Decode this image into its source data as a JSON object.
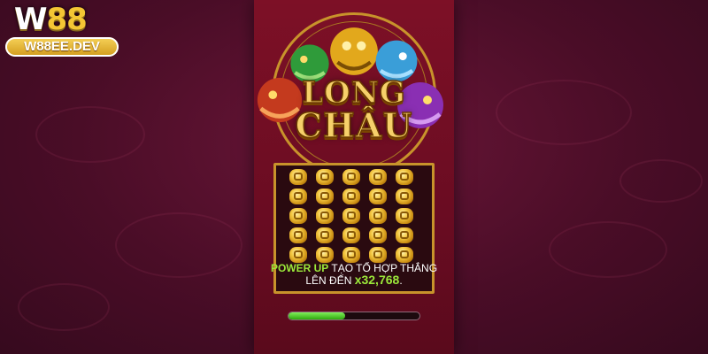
{
  "brand": {
    "mark_prefix": "W",
    "mark_suffix": "88",
    "url": "W88EE.DEV"
  },
  "game": {
    "title_line1": "LONG",
    "title_line2": "CHÂU",
    "caption": {
      "power_up": "POWER UP",
      "line1_rest": " TẠO TỔ HỢP THẮNG",
      "line2_prefix": "LÊN ĐẾN ",
      "multiplier": "x32,768",
      "line2_suffix": "."
    },
    "reel_symbols": [
      "gold-coin"
    ],
    "loading_progress": 0.43
  },
  "colors": {
    "background": "#4a0d27",
    "panel": "#6a0c22",
    "gold": "#c8932b",
    "highlight": "#9be83a",
    "progress": "#46c21e"
  }
}
